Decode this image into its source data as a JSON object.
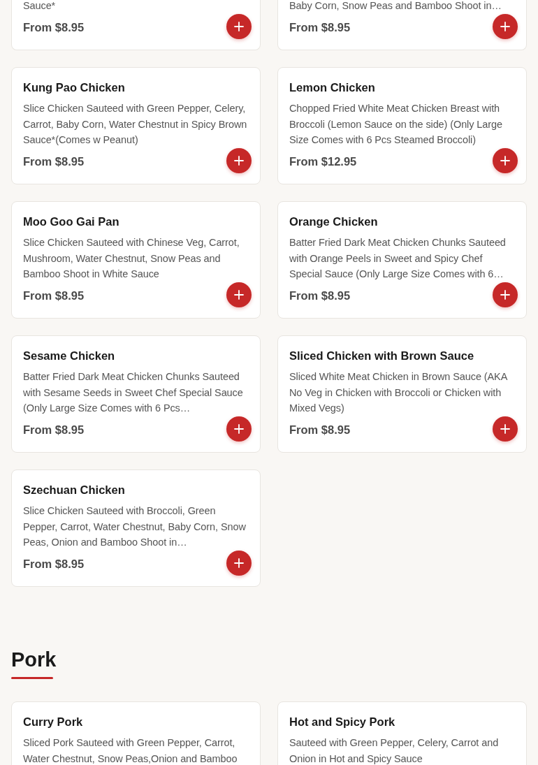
{
  "sections": [
    {
      "items": [
        {
          "description": "Sauce*",
          "price": "From $8.95"
        },
        {
          "description": "Baby Corn, Snow Peas and Bamboo Shoot in…",
          "price": "From $8.95"
        },
        {
          "name": "Kung Pao Chicken",
          "description": "Slice Chicken Sauteed with Green Pepper, Celery, Carrot, Baby Corn, Water Chestnut in Spicy Brown Sauce*(Comes w Peanut)",
          "price": "From $8.95"
        },
        {
          "name": "Lemon Chicken",
          "description": "Chopped Fried White Meat Chicken Breast with Broccoli (Lemon Sauce on the side) (Only Large Size Comes with 6 Pcs Steamed Broccoli)",
          "price": "From $12.95"
        },
        {
          "name": "Moo Goo Gai Pan",
          "description": "Slice Chicken Sauteed with Chinese Veg, Carrot, Mushroom, Water Chestnut, Snow Peas and Bamboo Shoot in White Sauce",
          "price": "From $8.95"
        },
        {
          "name": "Orange Chicken",
          "description": "Batter Fried Dark Meat Chicken Chunks Sauteed with Orange Peels in Sweet and Spicy Chef Special Sauce (Only Large Size Comes with 6…",
          "price": "From $8.95"
        },
        {
          "name": "Sesame Chicken",
          "description": "Batter Fried Dark Meat Chicken Chunks Sauteed with Sesame Seeds in Sweet Chef Special Sauce (Only Large Size Comes with 6 Pcs…",
          "price": "From $8.95"
        },
        {
          "name": "Sliced Chicken with Brown Sauce",
          "description": "Sliced White Meat Chicken in Brown Sauce (AKA No Veg in Chicken with Broccoli or Chicken with Mixed Vegs)",
          "price": "From $8.95"
        },
        {
          "name": "Szechuan Chicken",
          "description": "Slice Chicken Sauteed with Broccoli, Green Pepper, Carrot, Water Chestnut, Baby Corn, Snow Peas, Onion and Bamboo Shoot in…",
          "price": "From $8.95"
        }
      ]
    },
    {
      "heading": "Pork",
      "items": [
        {
          "name": "Curry Pork",
          "description": "Sliced Pork Sauteed with Green Pepper, Carrot, Water Chestnut, Snow Peas,Onion and Bamboo"
        },
        {
          "name": "Hot and Spicy Pork",
          "description": "Sauteed with Green Pepper, Celery, Carrot and Onion in Hot and Spicy Sauce"
        }
      ]
    }
  ]
}
